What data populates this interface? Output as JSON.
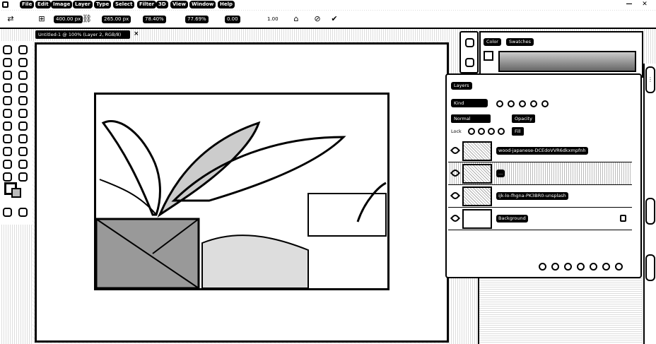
{
  "menu": {
    "items": [
      "File",
      "Edit",
      "Image",
      "Layer",
      "Type",
      "Select",
      "Filter",
      "3D",
      "View",
      "Window",
      "Help"
    ]
  },
  "window_controls": {
    "minimize": "—",
    "close": "✕"
  },
  "options_bar": {
    "width_value": "400.00 px",
    "height_value": "265.00 px",
    "x_value": "78.40%",
    "y_value": "77.69%",
    "angle_value": "0.00",
    "interp_value": "1.00",
    "cancel_glyph": "⊘",
    "commit_glyph": "✔"
  },
  "document_tab": {
    "title": "Untitled-1 @ 100% (Layer 2, RGB/8)",
    "close_glyph": "×"
  },
  "color_panel": {
    "tabs": [
      "Color",
      "Swatches"
    ]
  },
  "layers_panel": {
    "title": "Layers",
    "kind_filter": "Kind",
    "blend_mode": "Normal",
    "opacity": "Opacity",
    "lock_label": "Lock",
    "fill": "Fill",
    "layers": [
      {
        "name": "wood-japanese-DCEdoVVR6dkxmpfnh",
        "visible": true,
        "selected": false,
        "locked": false
      },
      {
        "name": "...",
        "visible": true,
        "selected": true,
        "locked": false
      },
      {
        "name": "ijk-lo-fhgna-PK3BR0-unsplash",
        "visible": true,
        "selected": false,
        "locked": false
      },
      {
        "name": "Background",
        "visible": true,
        "selected": false,
        "locked": true
      }
    ]
  },
  "icons": [
    "app-icon",
    "move-icon",
    "eye-icon",
    "lock-icon",
    "fx-icon",
    "mask-icon",
    "adjustment-icon",
    "folder-icon",
    "new-layer-icon",
    "trash-icon"
  ],
  "colors": {
    "ink": "#000000",
    "paper": "#ffffff"
  }
}
